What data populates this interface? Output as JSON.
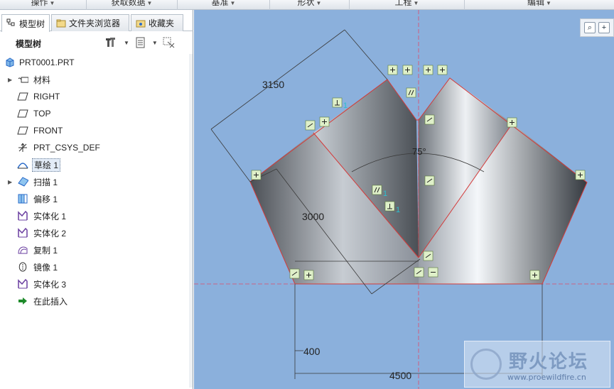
{
  "ribbon": {
    "groups": [
      {
        "label": "操作"
      },
      {
        "label": "获取数据"
      },
      {
        "label": "基准"
      },
      {
        "label": "形状"
      },
      {
        "label": "工程"
      },
      {
        "label": "编辑"
      }
    ]
  },
  "tabs": [
    {
      "label": "模型树",
      "icon": "model-tree-icon"
    },
    {
      "label": "文件夹浏览器",
      "icon": "folder-browser-icon"
    },
    {
      "label": "收藏夹",
      "icon": "favorites-icon"
    }
  ],
  "tree_toolbar": {
    "title": "模型树",
    "buttons": [
      "settings-icon",
      "show-icon",
      "filter-icon"
    ]
  },
  "tree": [
    {
      "label": "PRT0001.PRT",
      "icon": "part-icon",
      "root": true
    },
    {
      "label": "材料",
      "icon": "material-icon",
      "expandable": true
    },
    {
      "label": "RIGHT",
      "icon": "datum-plane-icon"
    },
    {
      "label": "TOP",
      "icon": "datum-plane-icon"
    },
    {
      "label": "FRONT",
      "icon": "datum-plane-icon"
    },
    {
      "label": "PRT_CSYS_DEF",
      "icon": "csys-icon"
    },
    {
      "label": "草绘 1",
      "icon": "sketch-icon",
      "selected": true
    },
    {
      "label": "扫描 1",
      "icon": "sweep-icon",
      "expandable": true
    },
    {
      "label": "偏移 1",
      "icon": "offset-icon"
    },
    {
      "label": "实体化 1",
      "icon": "solidify-icon"
    },
    {
      "label": "实体化 2",
      "icon": "solidify-icon"
    },
    {
      "label": "复制 1",
      "icon": "copy-icon"
    },
    {
      "label": "镜像 1",
      "icon": "mirror-icon"
    },
    {
      "label": "实体化 3",
      "icon": "solidify-icon"
    },
    {
      "label": "在此插入",
      "icon": "insert-arrow-icon"
    }
  ],
  "sketch": {
    "dimensions": {
      "d_3150": "3150",
      "d_3000": "3000",
      "angle": "75°",
      "d_400": "400",
      "d_4500": "4500"
    },
    "constraint_labels": {
      "perp": "1",
      "parallel": "1",
      "equal": "1"
    },
    "colors": {
      "background": "#8bb0dc",
      "edge": "#d33a3a",
      "centerline": "#e04a6a",
      "dimension": "#3a3a3a",
      "constraint_text": "#2bc0d0"
    }
  },
  "view_toolbar": {
    "buttons": [
      "zoom-fit-icon",
      "zoom-icon"
    ]
  },
  "watermark": {
    "title": "野火论坛",
    "url": "www.proewildfire.cn"
  }
}
